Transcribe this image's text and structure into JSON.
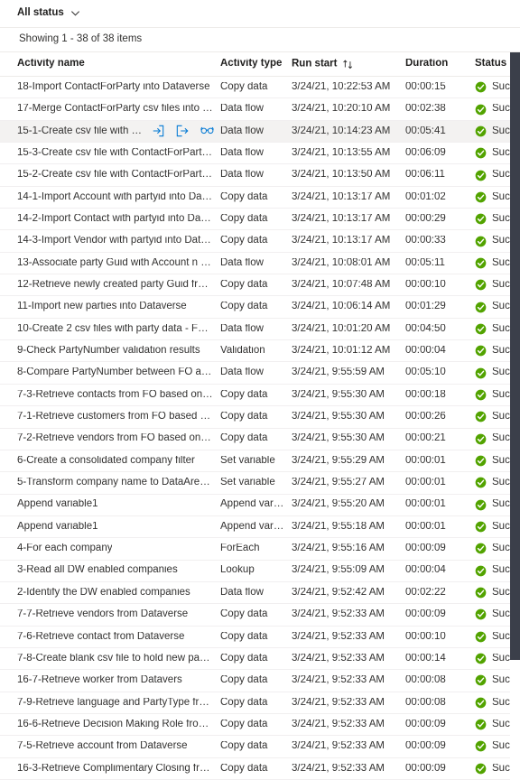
{
  "filter": {
    "label": "All status",
    "chevron_icon": "chevron-down-icon"
  },
  "summary": {
    "showing_text": "Showing 1 - 38 of 38 items"
  },
  "colors": {
    "accent": "#0078d4",
    "success": "#52a300",
    "selected_row": "#f3f2f1",
    "scrollbar": "#3b3f4a",
    "text": "#323130"
  },
  "table": {
    "columns": [
      {
        "key": "name",
        "label": "Activity name"
      },
      {
        "key": "type",
        "label": "Activity type"
      },
      {
        "key": "start",
        "label": "Run start",
        "sort_icon": "sort-ascending-descending-icon"
      },
      {
        "key": "duration",
        "label": "Duration"
      },
      {
        "key": "status",
        "label": "Status"
      }
    ],
    "row_actions": [
      {
        "icon": "input-arrow-icon",
        "title": "Input"
      },
      {
        "icon": "output-arrow-icon",
        "title": "Output"
      },
      {
        "icon": "glasses-icon",
        "title": "Details"
      }
    ],
    "rows": [
      {
        "name": "18-Import ContactForParty into Dataverse",
        "type": "Copy data",
        "start": "3/24/21, 10:22:53 AM",
        "duration": "00:00:15",
        "status": "Succeeded",
        "selected": false
      },
      {
        "name": "17-Merge ContactForParty csv files into one cs…",
        "type": "Data flow",
        "start": "3/24/21, 10:20:10 AM",
        "duration": "00:02:38",
        "status": "Succeeded",
        "selected": false
      },
      {
        "name": "15-1-Create csv file with Cont…",
        "type": "Data flow",
        "start": "3/24/21, 10:14:23 AM",
        "duration": "00:05:41",
        "status": "Succeeded",
        "selected": true
      },
      {
        "name": "15-3-Create csv file with ContactForParty for V…",
        "type": "Data flow",
        "start": "3/24/21, 10:13:55 AM",
        "duration": "00:06:09",
        "status": "Succeeded",
        "selected": false
      },
      {
        "name": "15-2-Create csv file with ContactForParty for C…",
        "type": "Data flow",
        "start": "3/24/21, 10:13:50 AM",
        "duration": "00:06:11",
        "status": "Succeeded",
        "selected": false
      },
      {
        "name": "14-1-Import Account with partyid into Dataverse",
        "type": "Copy data",
        "start": "3/24/21, 10:13:17 AM",
        "duration": "00:01:02",
        "status": "Succeeded",
        "selected": false
      },
      {
        "name": "14-2-Import Contact with partyid into Dataverse",
        "type": "Copy data",
        "start": "3/24/21, 10:13:17 AM",
        "duration": "00:00:29",
        "status": "Succeeded",
        "selected": false
      },
      {
        "name": "14-3-Import Vendor with partyid into Dataverse",
        "type": "Copy data",
        "start": "3/24/21, 10:13:17 AM",
        "duration": "00:00:33",
        "status": "Succeeded",
        "selected": false
      },
      {
        "name": "13-Associate party Guid with Account n Contac…",
        "type": "Data flow",
        "start": "3/24/21, 10:08:01 AM",
        "duration": "00:05:11",
        "status": "Succeeded",
        "selected": false
      },
      {
        "name": "12-Retrieve newly created party Guid from Dat…",
        "type": "Copy data",
        "start": "3/24/21, 10:07:48 AM",
        "duration": "00:00:10",
        "status": "Succeeded",
        "selected": false
      },
      {
        "name": "11-Import new parties into Dataverse",
        "type": "Copy data",
        "start": "3/24/21, 10:06:14 AM",
        "duration": "00:01:29",
        "status": "Succeeded",
        "selected": false
      },
      {
        "name": "10-Create 2 csv files with party data - FO n Dat…",
        "type": "Data flow",
        "start": "3/24/21, 10:01:20 AM",
        "duration": "00:04:50",
        "status": "Succeeded",
        "selected": false
      },
      {
        "name": "9-Check PartyNumber validation results",
        "type": "Validation",
        "start": "3/24/21, 10:01:12 AM",
        "duration": "00:00:04",
        "status": "Succeeded",
        "selected": false
      },
      {
        "name": "8-Compare PartyNumber between FO and Dat…",
        "type": "Data flow",
        "start": "3/24/21, 9:55:59 AM",
        "duration": "00:05:10",
        "status": "Succeeded",
        "selected": false
      },
      {
        "name": "7-3-Retrieve contacts from FO based on comp…",
        "type": "Copy data",
        "start": "3/24/21, 9:55:30 AM",
        "duration": "00:00:18",
        "status": "Succeeded",
        "selected": false
      },
      {
        "name": "7-1-Retrieve customers from FO based on com…",
        "type": "Copy data",
        "start": "3/24/21, 9:55:30 AM",
        "duration": "00:00:26",
        "status": "Succeeded",
        "selected": false
      },
      {
        "name": "7-2-Retrieve vendors from FO based on compa…",
        "type": "Copy data",
        "start": "3/24/21, 9:55:30 AM",
        "duration": "00:00:21",
        "status": "Succeeded",
        "selected": false
      },
      {
        "name": "6-Create a consolidated company filter",
        "type": "Set variable",
        "start": "3/24/21, 9:55:29 AM",
        "duration": "00:00:01",
        "status": "Succeeded",
        "selected": false
      },
      {
        "name": "5-Transform company name to DataAreaId",
        "type": "Set variable",
        "start": "3/24/21, 9:55:27 AM",
        "duration": "00:00:01",
        "status": "Succeeded",
        "selected": false
      },
      {
        "name": "Append variable1",
        "type": "Append variable",
        "start": "3/24/21, 9:55:20 AM",
        "duration": "00:00:01",
        "status": "Succeeded",
        "selected": false
      },
      {
        "name": "Append variable1",
        "type": "Append variable",
        "start": "3/24/21, 9:55:18 AM",
        "duration": "00:00:01",
        "status": "Succeeded",
        "selected": false
      },
      {
        "name": "4-For each company",
        "type": "ForEach",
        "start": "3/24/21, 9:55:16 AM",
        "duration": "00:00:09",
        "status": "Succeeded",
        "selected": false
      },
      {
        "name": "3-Read all DW enabled companies",
        "type": "Lookup",
        "start": "3/24/21, 9:55:09 AM",
        "duration": "00:00:04",
        "status": "Succeeded",
        "selected": false
      },
      {
        "name": "2-Identify the DW enabled companies",
        "type": "Data flow",
        "start": "3/24/21, 9:52:42 AM",
        "duration": "00:02:22",
        "status": "Succeeded",
        "selected": false
      },
      {
        "name": "7-7-Retrieve vendors from Dataverse",
        "type": "Copy data",
        "start": "3/24/21, 9:52:33 AM",
        "duration": "00:00:09",
        "status": "Succeeded",
        "selected": false
      },
      {
        "name": "7-6-Retrieve contact from Dataverse",
        "type": "Copy data",
        "start": "3/24/21, 9:52:33 AM",
        "duration": "00:00:10",
        "status": "Succeeded",
        "selected": false
      },
      {
        "name": "7-8-Create blank csv file to hold new parties fo…",
        "type": "Copy data",
        "start": "3/24/21, 9:52:33 AM",
        "duration": "00:00:14",
        "status": "Succeeded",
        "selected": false
      },
      {
        "name": "16-7-Retrieve worker from Datavers",
        "type": "Copy data",
        "start": "3/24/21, 9:52:33 AM",
        "duration": "00:00:08",
        "status": "Succeeded",
        "selected": false
      },
      {
        "name": "7-9-Retrieve language and PartyType from Dat…",
        "type": "Copy data",
        "start": "3/24/21, 9:52:33 AM",
        "duration": "00:00:08",
        "status": "Succeeded",
        "selected": false
      },
      {
        "name": "16-6-Retrieve Decision Making Role from Data…",
        "type": "Copy data",
        "start": "3/24/21, 9:52:33 AM",
        "duration": "00:00:09",
        "status": "Succeeded",
        "selected": false
      },
      {
        "name": "7-5-Retrieve account from Dataverse",
        "type": "Copy data",
        "start": "3/24/21, 9:52:33 AM",
        "duration": "00:00:09",
        "status": "Succeeded",
        "selected": false
      },
      {
        "name": "16-3-Retrieve Complimentary Closing from Dat…",
        "type": "Copy data",
        "start": "3/24/21, 9:52:33 AM",
        "duration": "00:00:09",
        "status": "Succeeded",
        "selected": false
      }
    ]
  },
  "scrollbar": {
    "name": "vertical-scrollbar"
  }
}
